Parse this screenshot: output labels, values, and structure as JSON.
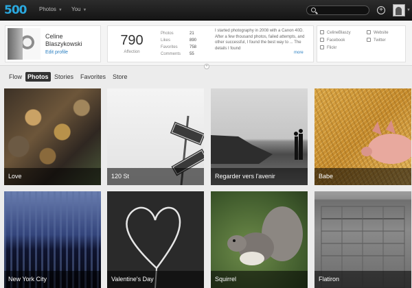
{
  "app": {
    "logo": "500"
  },
  "nav": [
    {
      "label": "Photos"
    },
    {
      "label": "You"
    }
  ],
  "search": {
    "placeholder": ""
  },
  "profile": {
    "name": "Celine Blaszykowski",
    "edit_link": "Edit profile",
    "affection_value": "790",
    "affection_label": "Affection",
    "stats": [
      {
        "label": "Photos",
        "value": "21"
      },
      {
        "label": "Likes",
        "value": "890"
      },
      {
        "label": "Favorites",
        "value": "758"
      },
      {
        "label": "Comments",
        "value": "55"
      }
    ],
    "bio": "I started photography in 2008 with a Canon 40D. After a few thousand photos, failed attempts, and other successful, I found the best way to ... The details I found",
    "bio_more": "more",
    "social": [
      {
        "label": "CelineBlaszy",
        "icon": "twitter-icon"
      },
      {
        "label": "Facebook",
        "icon": "facebook-icon"
      },
      {
        "label": "Flickr",
        "icon": "flickr-icon"
      }
    ],
    "links": [
      {
        "label": "Website",
        "icon": "website-icon"
      },
      {
        "label": "Twitter",
        "icon": "twitter-icon"
      }
    ]
  },
  "tabs": [
    {
      "label": "Flow",
      "active": false
    },
    {
      "label": "Photos",
      "active": true
    },
    {
      "label": "Stories",
      "active": false
    },
    {
      "label": "Favorites",
      "active": false
    },
    {
      "label": "Store",
      "active": false
    }
  ],
  "photos": [
    {
      "title": "Love"
    },
    {
      "title": "120 St"
    },
    {
      "title": "Regarder vers l'avenir"
    },
    {
      "title": "Babe"
    },
    {
      "title": "New York City"
    },
    {
      "title": "Valentine's Day"
    },
    {
      "title": "Squirrel"
    },
    {
      "title": "Flatiron"
    }
  ],
  "colors": {
    "brand": "#2aa9e0",
    "topbar": "#1e1e1e",
    "link": "#2a7fc1"
  }
}
